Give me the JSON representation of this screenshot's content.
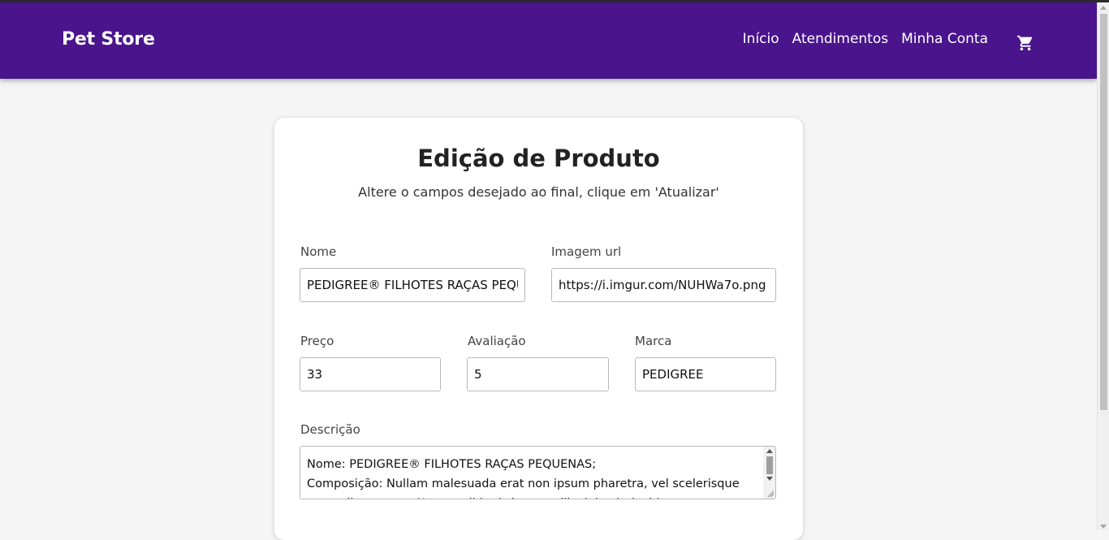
{
  "navbar": {
    "brand": "Pet Store",
    "links": [
      "Início",
      "Atendimentos",
      "Minha Conta"
    ],
    "cart_icon": "shopping-cart-icon"
  },
  "form": {
    "title": "Edição de Produto",
    "subtitle": "Altere o campos desejado ao final, clique em 'Atualizar'",
    "fields": {
      "nome": {
        "label": "Nome",
        "value": "PEDIGREE® FILHOTES RAÇAS PEQUENAS"
      },
      "imagem": {
        "label": "Imagem url",
        "value": "https://i.imgur.com/NUHWa7o.png"
      },
      "preco": {
        "label": "Preço",
        "value": "33"
      },
      "avaliacao": {
        "label": "Avaliação",
        "value": "5"
      },
      "marca": {
        "label": "Marca",
        "value": "PEDIGREE"
      },
      "descricao": {
        "label": "Descrição",
        "value": "Nome: PEDIGREE® FILHOTES RAÇAS PEQUENAS;\nComposição: Nullam malesuada erat non ipsum pharetra, vel scelerisque nunc ullamcorper. Nunc a nibh ultrices, mollis dui vel, tincidunt erat."
      }
    }
  },
  "colors": {
    "navbar": "#4a148c",
    "background": "#f5f5f5",
    "card": "#ffffff"
  }
}
